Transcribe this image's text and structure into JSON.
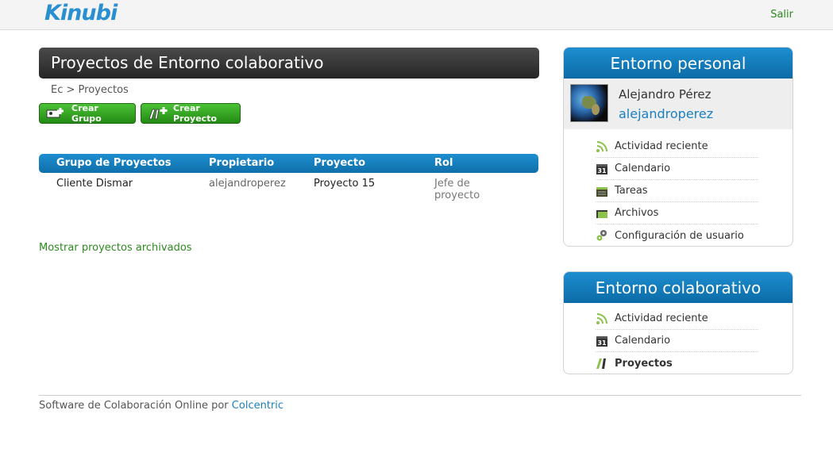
{
  "header": {
    "logo_text": "Kinubi",
    "logout_label": "Salir"
  },
  "main": {
    "title": "Proyectos de Entorno colaborativo",
    "breadcrumb": "Ec > Proyectos",
    "buttons": {
      "create_group": "Crear Grupo",
      "create_project": "Crear Proyecto"
    },
    "table": {
      "columns": [
        "Grupo de Proyectos",
        "Propietario",
        "Proyecto",
        "Rol"
      ],
      "rows": [
        [
          "Cliente Dismar",
          "alejandroperez",
          "Proyecto 15",
          "Jefe de\nproyecto"
        ]
      ]
    },
    "show_archived": "Mostrar proyectos archivados"
  },
  "personal_panel": {
    "title": "Entorno personal",
    "profile_name": "Alejandro Pérez",
    "profile_user": "alejandroperez",
    "items": [
      {
        "label": "Actividad reciente",
        "icon": "rss-icon"
      },
      {
        "label": "Calendario",
        "icon": "calendar-icon"
      },
      {
        "label": "Tareas",
        "icon": "tasks-icon"
      },
      {
        "label": "Archivos",
        "icon": "folder-icon"
      },
      {
        "label": "Configuración de usuario",
        "icon": "gear-icon"
      }
    ]
  },
  "collab_panel": {
    "title": "Entorno colaborativo",
    "items": [
      {
        "label": "Actividad reciente",
        "icon": "rss-icon"
      },
      {
        "label": "Calendario",
        "icon": "calendar-icon"
      },
      {
        "label": "Proyectos",
        "icon": "projects-icon"
      }
    ]
  },
  "footer": {
    "text": "Software de Colaboración Online por",
    "link": "Colcentric"
  },
  "colors": {
    "accent_blue": "#1a7fc0",
    "green": "#2d8a1f",
    "header_dark": "#333333"
  }
}
